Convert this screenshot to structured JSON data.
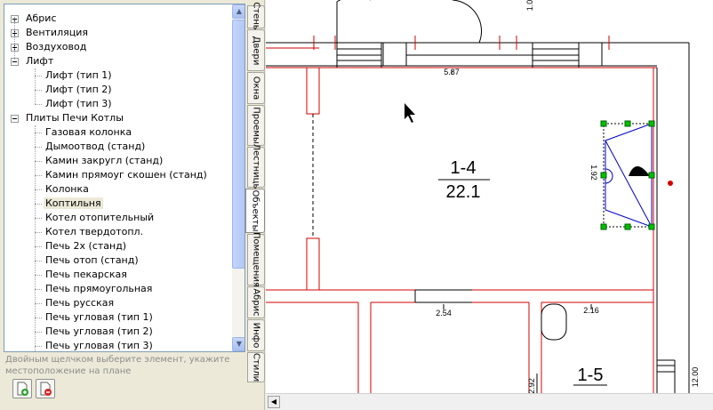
{
  "tree": {
    "items": [
      {
        "label": "Абрис",
        "expander": "plus"
      },
      {
        "label": "Вентиляция",
        "expander": "plus"
      },
      {
        "label": "Воздуховод",
        "expander": "plus"
      },
      {
        "label": "Лифт",
        "expander": "minus"
      },
      {
        "label": "Лифт (тип 1)"
      },
      {
        "label": "Лифт (тип 2)"
      },
      {
        "label": "Лифт (тип 3)"
      },
      {
        "label": "Плиты Печи Котлы",
        "expander": "minus"
      },
      {
        "label": "Газовая колонка"
      },
      {
        "label": "Дымоотвод (станд)"
      },
      {
        "label": "Камин закругл (станд)"
      },
      {
        "label": "Камин прямоуг скошен (станд)"
      },
      {
        "label": "Колонка"
      },
      {
        "label": "Коптильня",
        "selected": true
      },
      {
        "label": "Котел отопительный"
      },
      {
        "label": "Котел твердотопл."
      },
      {
        "label": "Печь 2х (станд)"
      },
      {
        "label": "Печь отоп (станд)"
      },
      {
        "label": "Печь пекарская"
      },
      {
        "label": "Печь прямоугольная"
      },
      {
        "label": "Печь русская"
      },
      {
        "label": "Печь угловая (тип 1)"
      },
      {
        "label": "Печь угловая (тип 2)"
      },
      {
        "label": "Печь угловая (тип 3)"
      }
    ]
  },
  "hint": "Двойным щелчком выберите элемент, укажите местоположение на плане",
  "tabs": [
    {
      "label": "Стены"
    },
    {
      "label": "Двери"
    },
    {
      "label": "Окна"
    },
    {
      "label": "Проемы"
    },
    {
      "label": "Лестницы"
    },
    {
      "label": "Объекты",
      "active": true
    },
    {
      "label": "Помещения"
    },
    {
      "label": "Абрис"
    },
    {
      "label": "Инфо"
    },
    {
      "label": "Стили"
    }
  ],
  "plan": {
    "room_main_number": "1-4",
    "room_main_area": "22.1",
    "room_second_number": "1-5",
    "dim_top": "5.87",
    "dim_left_bottom": "2.54",
    "dim_right_bottom": "2.16",
    "dim_object": "1.92",
    "dim_right_edge": "12.00",
    "dim_top_right": "1.0",
    "dim_bottom_left": "2.92"
  },
  "colors": {
    "wall_red": "#d40000",
    "handle_green": "#00c000",
    "object_blue": "#0000c8"
  }
}
